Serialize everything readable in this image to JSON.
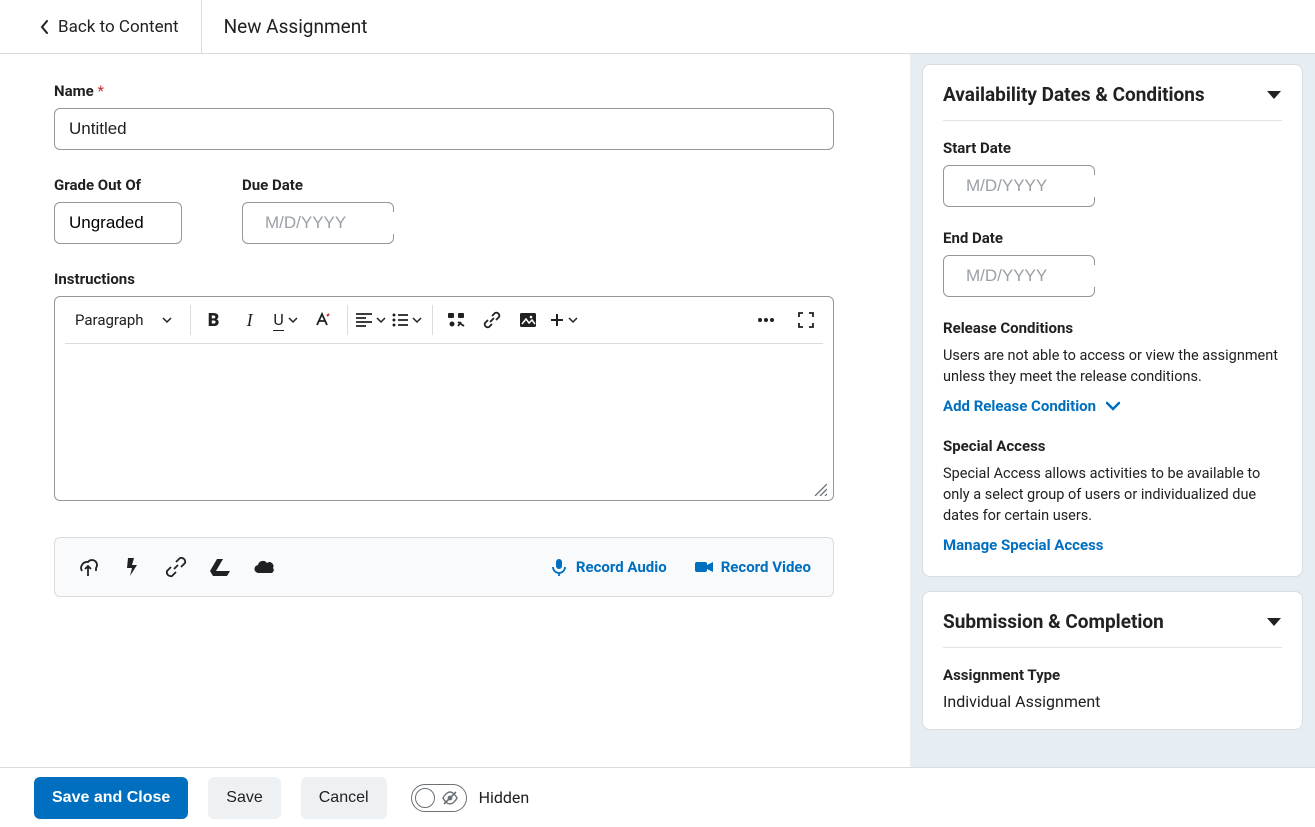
{
  "header": {
    "back_label": "Back to Content",
    "title": "New Assignment"
  },
  "form": {
    "name_label": "Name",
    "name_required": "*",
    "name_value": "Untitled",
    "grade_label": "Grade Out Of",
    "grade_value": "Ungraded",
    "due_label": "Due Date",
    "due_placeholder": "M/D/YYYY",
    "instructions_label": "Instructions"
  },
  "editor": {
    "paragraph_label": "Paragraph"
  },
  "attach": {
    "record_audio": "Record Audio",
    "record_video": "Record Video"
  },
  "side": {
    "availability": {
      "title": "Availability Dates & Conditions",
      "start_label": "Start Date",
      "start_placeholder": "M/D/YYYY",
      "end_label": "End Date",
      "end_placeholder": "M/D/YYYY",
      "release_title": "Release Conditions",
      "release_desc": "Users are not able to access or view the assignment unless they meet the release conditions.",
      "add_release": "Add Release Condition",
      "special_title": "Special Access",
      "special_desc": "Special Access allows activities to be available to only a select group of users or individualized due dates for certain users.",
      "manage_special": "Manage Special Access"
    },
    "submission": {
      "title": "Submission & Completion",
      "type_label": "Assignment Type",
      "type_value": "Individual Assignment"
    }
  },
  "footer": {
    "save_close": "Save and Close",
    "save": "Save",
    "cancel": "Cancel",
    "hidden": "Hidden"
  }
}
